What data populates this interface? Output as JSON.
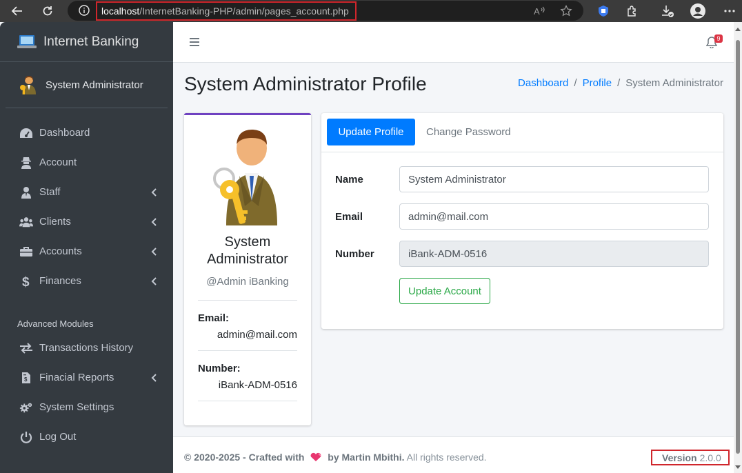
{
  "browser": {
    "url_host": "localhost",
    "url_path": "/InternetBanking-PHP/admin/pages_account.php"
  },
  "sidebar": {
    "brand": "Internet Banking",
    "user": "System Administrator",
    "items": [
      {
        "label": "Dashboard",
        "icon": "tachometer-icon"
      },
      {
        "label": "Account",
        "icon": "user-secret-icon"
      },
      {
        "label": "Staff",
        "icon": "user-tie-icon"
      },
      {
        "label": "Clients",
        "icon": "users-icon"
      },
      {
        "label": "Accounts",
        "icon": "briefcase-icon"
      },
      {
        "label": "Finances",
        "icon": "dollar-icon"
      }
    ],
    "section_header": "Advanced Modules",
    "advanced_items": [
      {
        "label": "Transactions History",
        "icon": "exchange-icon"
      },
      {
        "label": "Finacial Reports",
        "icon": "file-invoice-icon"
      },
      {
        "label": "System Settings",
        "icon": "cogs-icon"
      },
      {
        "label": "Log Out",
        "icon": "power-icon"
      }
    ]
  },
  "topbar": {
    "notification_count": "9"
  },
  "page": {
    "title": "System Administrator Profile",
    "breadcrumb": [
      "Dashboard",
      "Profile",
      "System Administrator"
    ]
  },
  "profile": {
    "name": "System Administrator",
    "handle": "@Admin iBanking",
    "email_label": "Email:",
    "email": "admin@mail.com",
    "number_label": "Number:",
    "number": "iBank-ADM-0516"
  },
  "form": {
    "tab_active": "Update Profile",
    "tab_other": "Change Password",
    "name_label": "Name",
    "name_value": "System Administrator",
    "email_label": "Email",
    "email_value": "admin@mail.com",
    "number_label": "Number",
    "number_value": "iBank-ADM-0516",
    "submit_label": "Update Account"
  },
  "footer": {
    "copyright": "© 2020-2025 - Crafted with",
    "author": "by Martin Mbithi.",
    "rights": "All rights reserved.",
    "version_label": "Version",
    "version": "2.0.0"
  },
  "colors": {
    "sidebar_bg": "#343a40",
    "primary": "#007bff",
    "success": "#28a745",
    "card_top_border": "#6f42c1",
    "highlight_box": "#d0262c"
  }
}
